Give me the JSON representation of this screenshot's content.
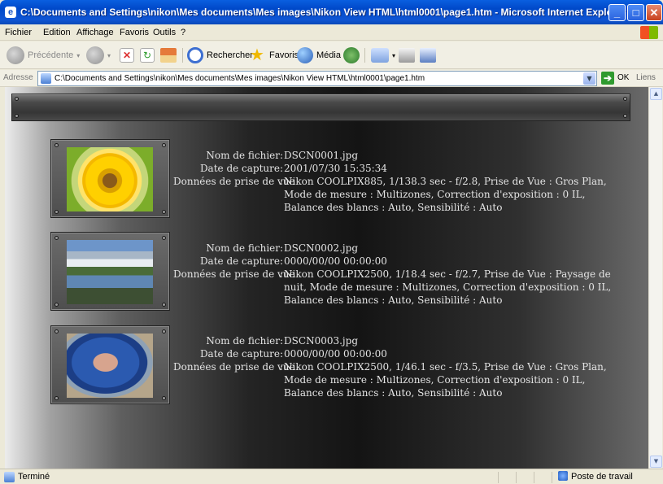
{
  "window": {
    "title": "C:\\Documents and Settings\\nikon\\Mes documents\\Mes images\\Nikon View HTML\\html0001\\page1.htm - Microsoft Internet Explorer"
  },
  "menu": [
    "Fichier",
    "Edition",
    "Affichage",
    "Favoris",
    "Outils",
    "?"
  ],
  "toolbar": {
    "back": "Précédente",
    "search": "Rechercher",
    "favorites": "Favoris",
    "media": "Média"
  },
  "address": {
    "label": "Adresse",
    "url": "C:\\Documents and Settings\\nikon\\Mes documents\\Mes images\\Nikon View HTML\\html0001\\page1.htm",
    "go": "OK",
    "links": "Liens"
  },
  "labels": {
    "file": "Nom de fichier",
    "date": "Date de capture",
    "shot": "Données de prise de vue"
  },
  "photos": [
    {
      "file": "DSCN0001.jpg",
      "date": "2001/07/30 15:35:34",
      "shot": "Nikon COOLPIX885, 1/138.3 sec - f/2.8, Prise de Vue : Gros Plan, Mode de mesure : Multizones, Correction d'exposition : 0 IL, Balance des blancs : Auto, Sensibilité : Auto"
    },
    {
      "file": "DSCN0002.jpg",
      "date": "0000/00/00 00:00:00",
      "shot": "Nikon COOLPIX2500, 1/18.4 sec - f/2.7, Prise de Vue : Paysage de nuit, Mode de mesure : Multizones, Correction d'exposition : 0 IL, Balance des blancs : Auto, Sensibilité : Auto"
    },
    {
      "file": "DSCN0003.jpg",
      "date": "0000/00/00 00:00:00",
      "shot": "Nikon COOLPIX2500, 1/46.1 sec - f/3.5, Prise de Vue : Gros Plan, Mode de mesure : Multizones, Correction d'exposition : 0 IL, Balance des blancs : Auto, Sensibilité : Auto"
    }
  ],
  "status": {
    "text": "Terminé",
    "zone": "Poste de travail"
  }
}
